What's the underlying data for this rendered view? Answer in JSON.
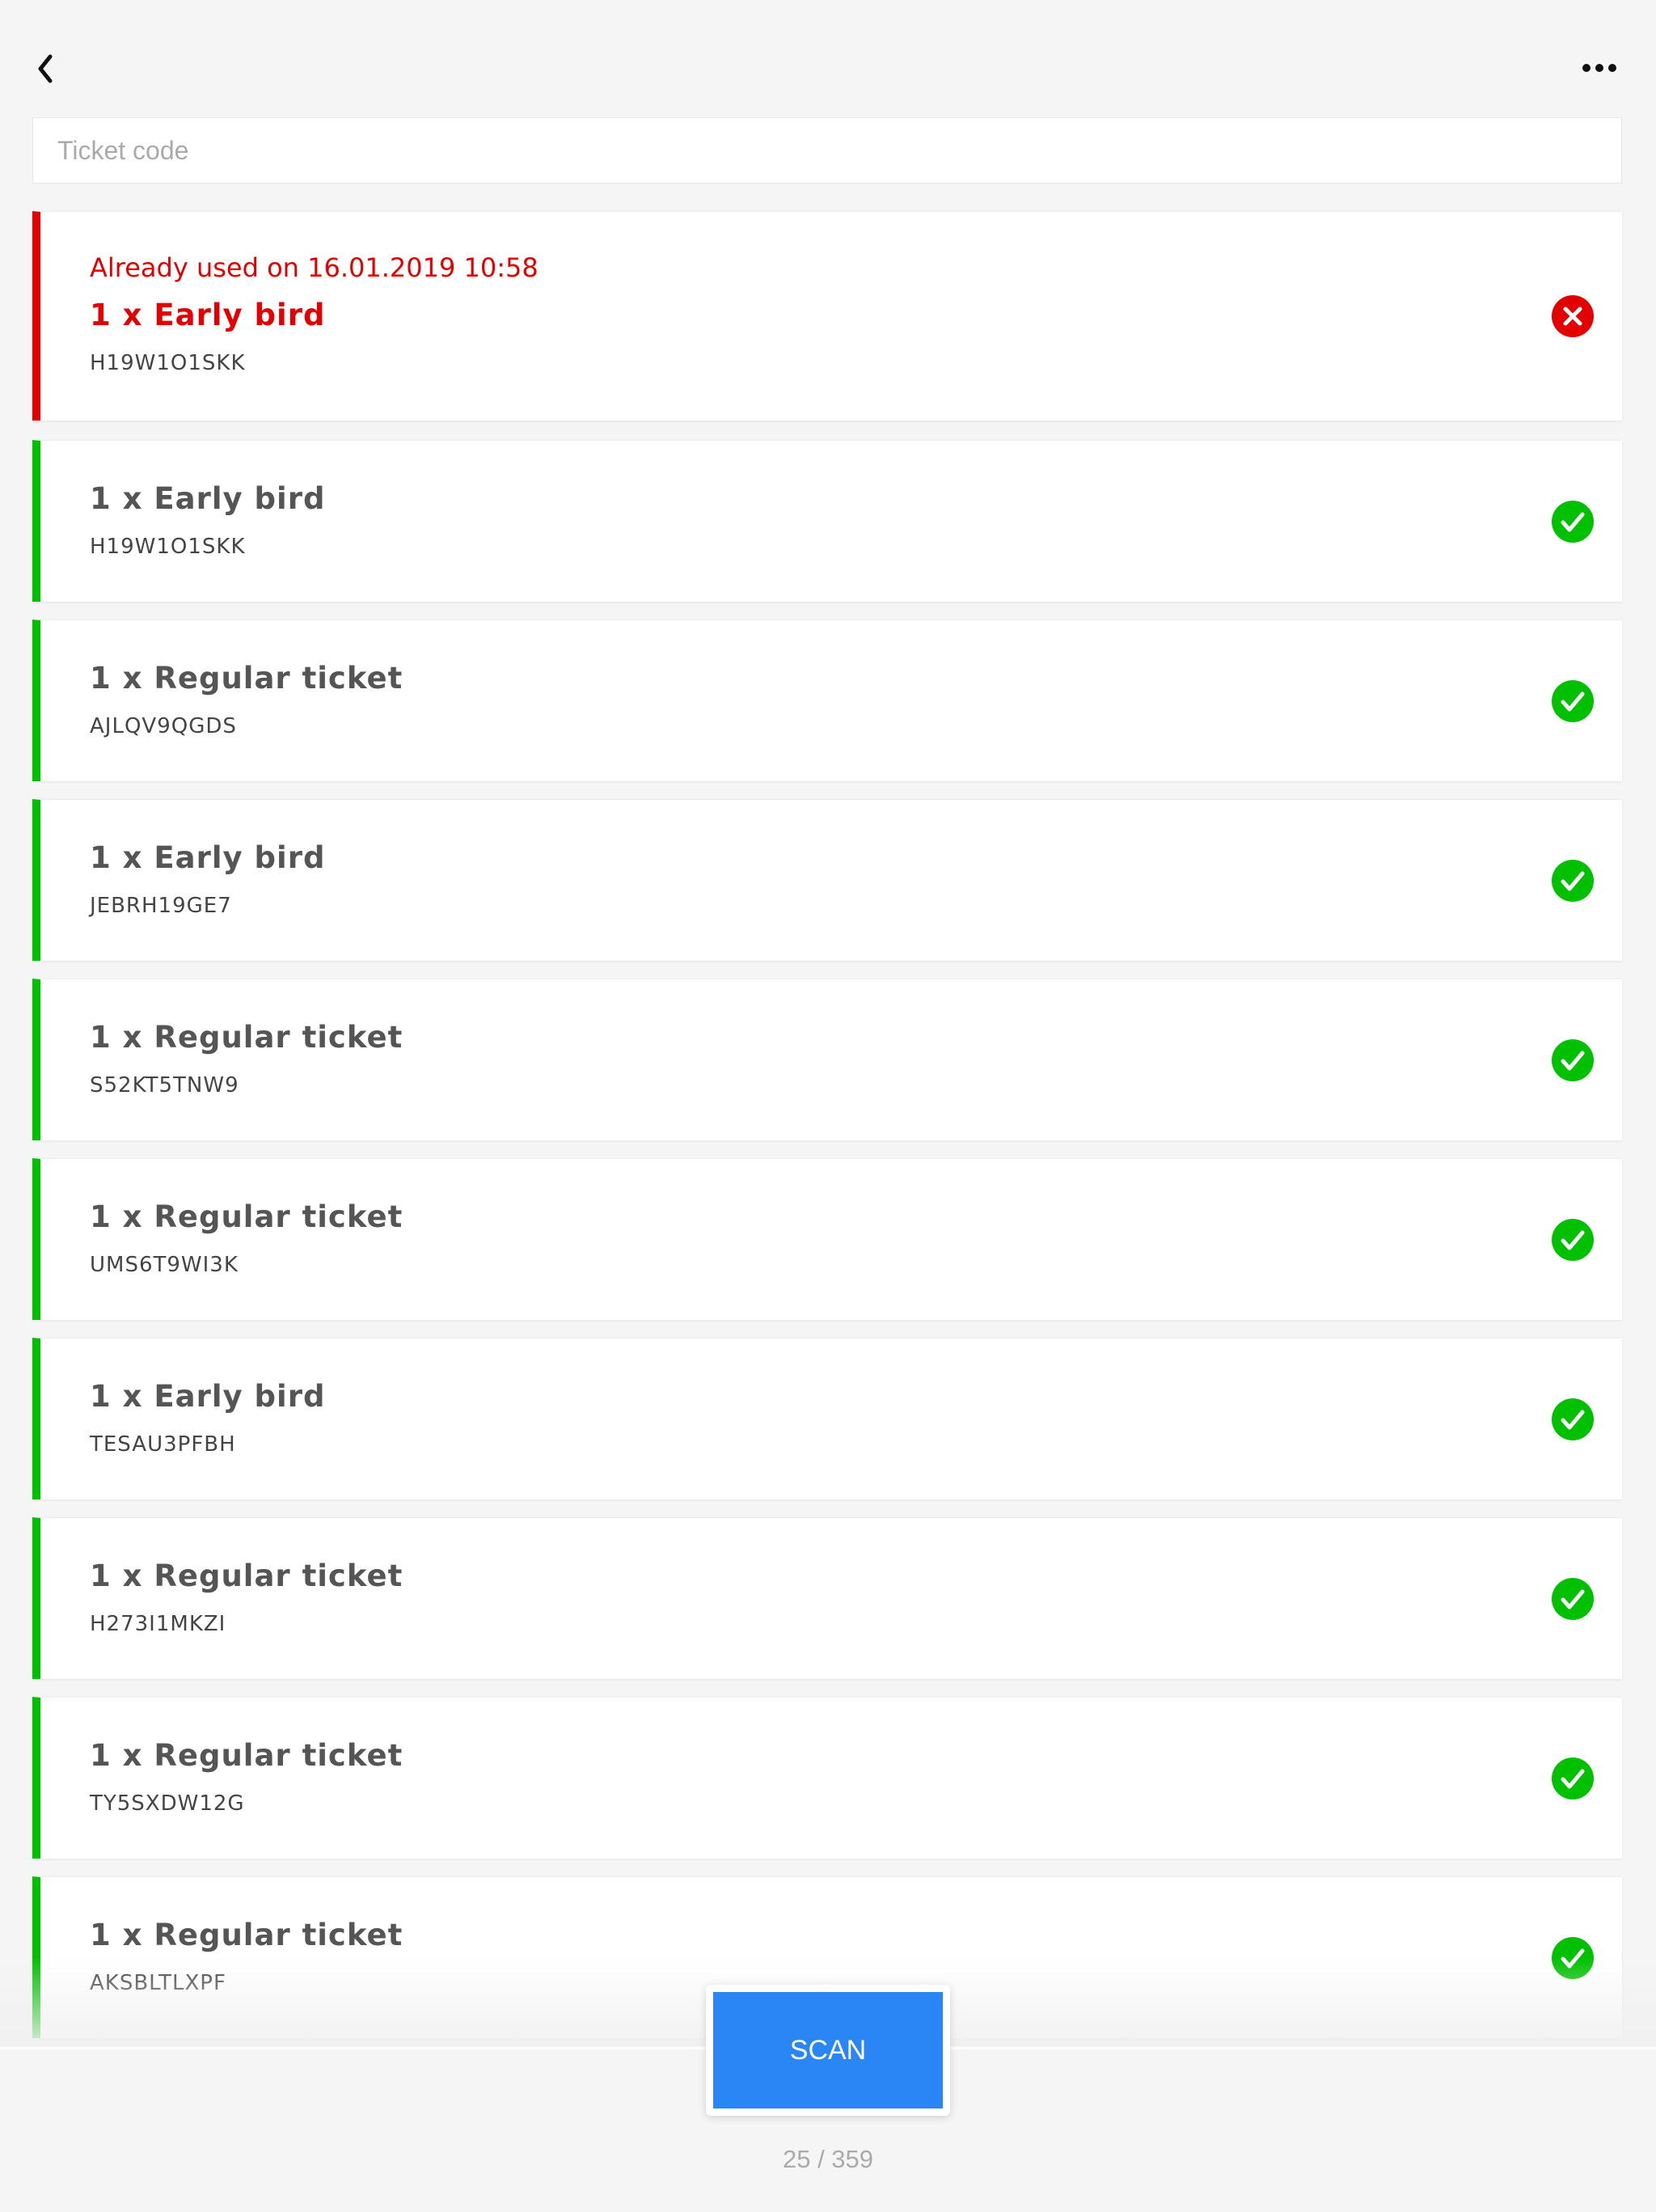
{
  "header": {
    "back_icon": "chevron-left-icon",
    "more_icon": "ellipsis-icon"
  },
  "search": {
    "placeholder": "Ticket code",
    "value": ""
  },
  "colors": {
    "error": "#e30000",
    "success": "#00c000",
    "scan_button": "#2a85f5"
  },
  "tickets": [
    {
      "status": "error",
      "notice": "Already used on 16.01.2019 10:58",
      "title": "1 x Early bird",
      "code": "H19W1O1SKK"
    },
    {
      "status": "ok",
      "title": "1 x Early bird",
      "code": "H19W1O1SKK"
    },
    {
      "status": "ok",
      "title": "1 x Regular ticket",
      "code": "AJLQV9QGDS"
    },
    {
      "status": "ok",
      "title": "1 x Early bird",
      "code": "JEBRH19GE7"
    },
    {
      "status": "ok",
      "title": "1 x Regular ticket",
      "code": "S52KT5TNW9"
    },
    {
      "status": "ok",
      "title": "1 x Regular ticket",
      "code": "UMS6T9WI3K"
    },
    {
      "status": "ok",
      "title": "1 x Early bird",
      "code": "TESAU3PFBH"
    },
    {
      "status": "ok",
      "title": "1 x Regular ticket",
      "code": "H273I1MKZI"
    },
    {
      "status": "ok",
      "title": "1 x Regular ticket",
      "code": "TY5SXDW12G"
    },
    {
      "status": "ok",
      "title": "1 x Regular ticket",
      "code": "AKSBLTLXPF"
    }
  ],
  "footer": {
    "scan_label": "SCAN",
    "counter": "25 / 359"
  }
}
